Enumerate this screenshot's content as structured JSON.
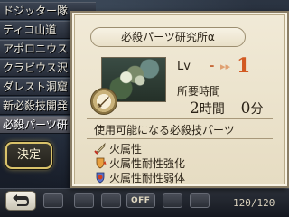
{
  "locations": [
    "ドジッター隊",
    "ティコ山道",
    "アポロニウス",
    "クラビウス沢",
    "ダレスト洞窟",
    "新必殺技開発",
    "必殺パーツ研"
  ],
  "selected_location_index": 6,
  "confirm_label": "決定",
  "panel": {
    "title": "必殺パーツ研究所α",
    "lv_label": "Lv",
    "lv_current": "-",
    "lv_arrow": "▸▸",
    "lv_next": "1",
    "time_label": "所要時間",
    "time_hours": "2",
    "time_hours_unit": "時間",
    "time_minutes": "0",
    "time_minutes_unit": "分",
    "skills_heading": "使用可能になる必殺技パーツ",
    "skills": [
      {
        "label": "火属性",
        "icon": "sword-icon"
      },
      {
        "label": "火属性耐性強化",
        "icon": "shield-up-icon"
      },
      {
        "label": "火属性耐性弱体",
        "icon": "shield-down-icon"
      }
    ]
  },
  "bottom_bar": {
    "off_label": "OFF",
    "counter": "120/120"
  },
  "colors": {
    "accent_level": "#d25a22",
    "confirm_border": "#d9c26a"
  }
}
